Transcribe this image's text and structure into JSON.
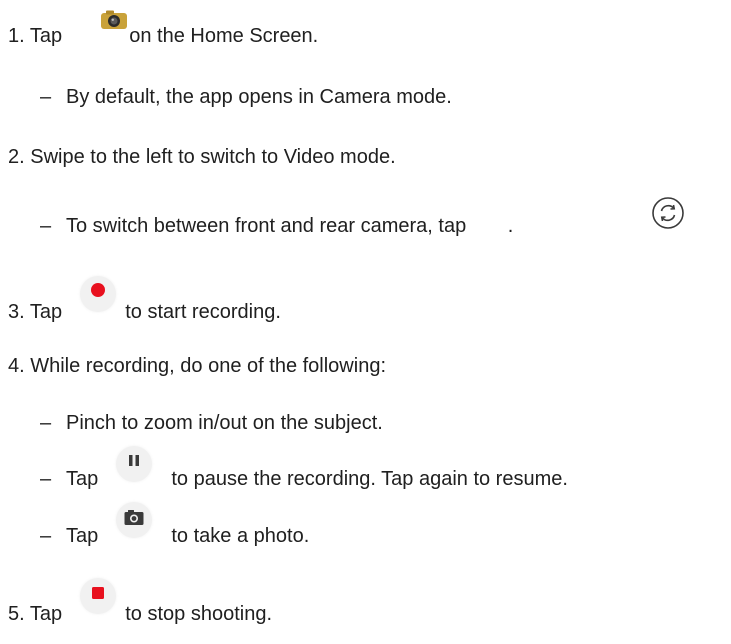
{
  "steps": [
    {
      "text_before": "1. Tap ",
      "text_after": " on the Home Screen."
    },
    {
      "text": "By default, the app opens in Camera mode."
    },
    {
      "text": "2. Swipe to the left to switch to Video mode."
    },
    {
      "text_before": "To switch between front and rear camera, tap ",
      "text_after": "."
    },
    {
      "text_before": "3. Tap ",
      "text_after": " to start recording."
    },
    {
      "text": "4. While recording, do one of the following:"
    },
    {
      "text": "Pinch to zoom in/out on the subject."
    },
    {
      "text_before": "Tap ",
      "text_after": " to pause the recording. Tap again to resume."
    },
    {
      "text_before": "Tap ",
      "text_after": " to take a photo."
    },
    {
      "text_before": "5. Tap ",
      "text_after": " to stop shooting."
    }
  ],
  "dash": "–",
  "icons": {
    "camera_app": "camera-app-icon",
    "switch_camera": "switch-camera-icon",
    "record": "record-icon",
    "pause": "pause-icon",
    "take_photo": "camera-shutter-icon",
    "stop": "stop-icon"
  },
  "colors": {
    "record_red": "#e8101e",
    "stop_red": "#e8101e",
    "button_bg": "#f1f1f1",
    "icon_dark": "#3a3a3a"
  }
}
